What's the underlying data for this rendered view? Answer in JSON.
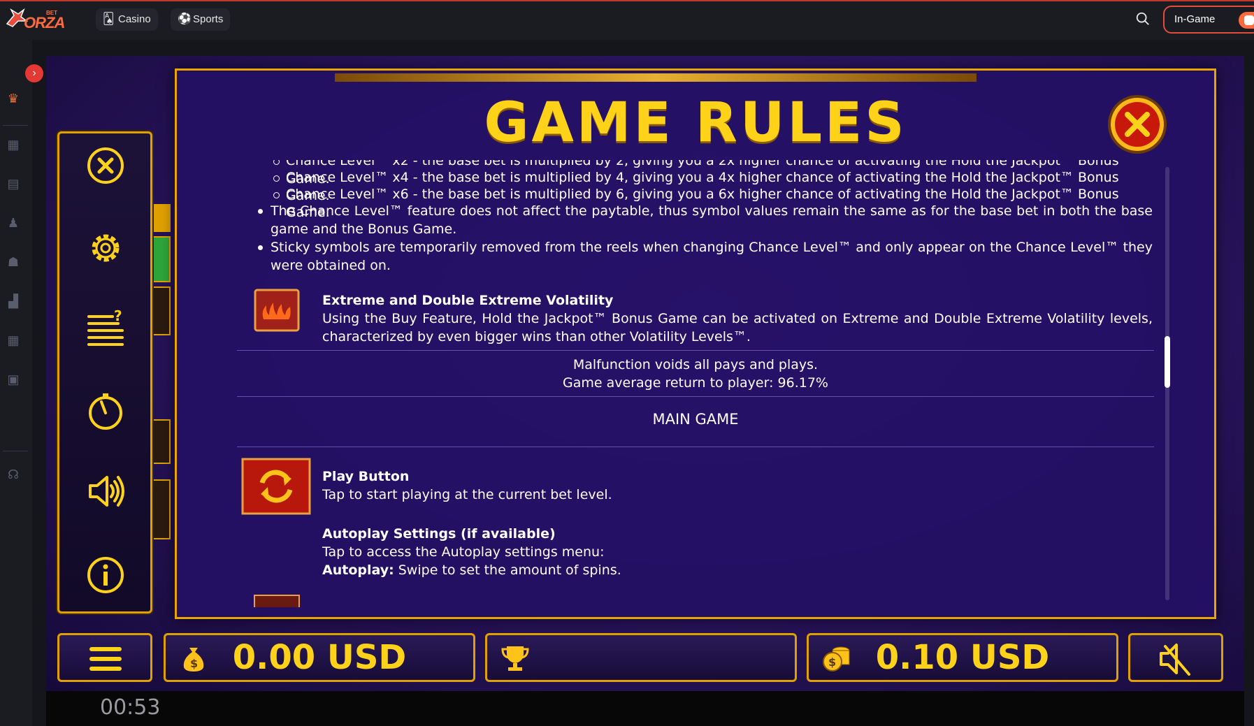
{
  "topbar": {
    "logo_small": "BET",
    "logo_main": "ORZA",
    "tabs": [
      {
        "label": "Casino",
        "icon": "casino-icon"
      },
      {
        "label": "Sports",
        "icon": "soccer-ball-icon"
      }
    ],
    "ingame_label": "In-Game"
  },
  "game": {
    "rules_title": "GAME RULES",
    "chance_items": [
      "Chance Level™ x2 - the base bet is multiplied by 2, giving you a 2x higher chance of activating the Hold the Jackpot™ Bonus Game.",
      "Chance Level™ x4 - the base bet is multiplied by 4, giving you a 4x higher chance of activating the Hold the Jackpot™ Bonus Game.",
      "Chance Level™ x6 - the base bet is multiplied by 6, giving you a 6x higher chance of activating the Hold the Jackpot™ Bonus Game."
    ],
    "bullets": [
      "The Chance Level™ feature does not affect the paytable, thus symbol values remain the same as for the base bet in both the base game and the Bonus Game.",
      "Sticky symbols are temporarily removed from the reels when changing Chance Level™ and only appear on the Chance Level™ they were obtained on."
    ],
    "volatility": {
      "title": "Extreme and Double Extreme Volatility",
      "text": "Using the Buy Feature, Hold the Jackpot™ Bonus Game can be activated on Extreme and Double Extreme Volatility levels, characterized by even bigger wins than other Volatility Levels™."
    },
    "malfunction": "Malfunction voids all pays and plays.",
    "rtp": "Game average return to player: 96.17%",
    "main_game_heading": "MAIN GAME",
    "play_button": {
      "title": "Play Button",
      "text": "Tap to start playing at the current bet level."
    },
    "autoplay": {
      "title": "Autoplay Settings (if available)",
      "text": "Tap to access the Autoplay settings menu:",
      "label": "Autoplay:",
      "detail": "Swipe to set the amount of spins."
    },
    "balance": "0.00 USD",
    "bet": "0.10 USD",
    "timer": "00:53"
  },
  "colors": {
    "accent": "#ffd21a",
    "frame": "#e0a000",
    "brand": "#ff6a3d"
  }
}
